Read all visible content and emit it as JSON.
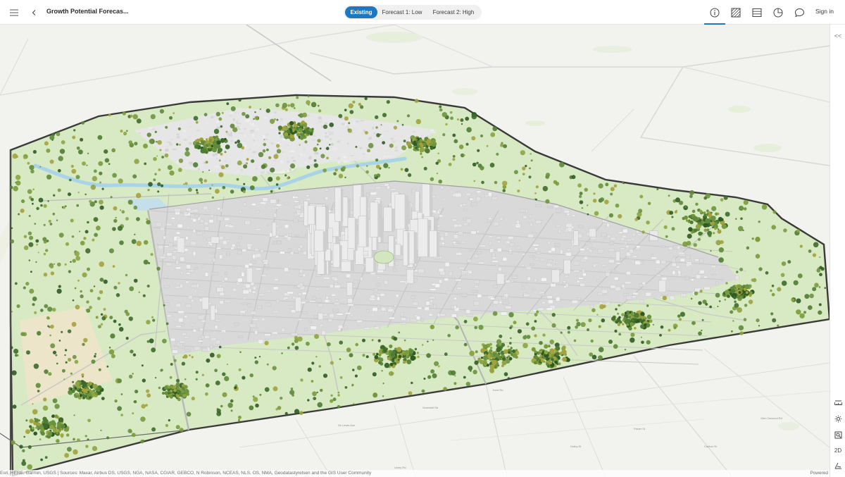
{
  "header": {
    "title": "Growth Potential Forecas...",
    "tabs": [
      {
        "label": "Existing",
        "active": true
      },
      {
        "label": "Forecast 1: Low",
        "active": false
      },
      {
        "label": "Forecast 2: High",
        "active": false
      }
    ],
    "tools": [
      "info-icon",
      "basemap-icon",
      "layers-icon",
      "chart-icon",
      "comment-icon"
    ],
    "sign_in": "Sign in"
  },
  "right_panel": {
    "collapse": "<<",
    "tools": [
      "measure-icon",
      "daylight-icon",
      "zoom-to-icon",
      "2D",
      "slice-icon"
    ]
  },
  "attribution": {
    "sources": "Esri, HERE, Garmin, USGS | Sources: Maxar, Airbus DS, USGS, NGA, NASA, CGIAR, GEBCO, N Robinson, NCEAS, NLS, OS, NMA, Geodatastyrelsen and the GIS User Community",
    "powered": "Powered"
  },
  "colors": {
    "accent": "#1d78c3",
    "parkland": "#d8eac3",
    "buildings": "#e2e2e2",
    "trees": "#4f7c33",
    "water": "#a9d3e6"
  }
}
